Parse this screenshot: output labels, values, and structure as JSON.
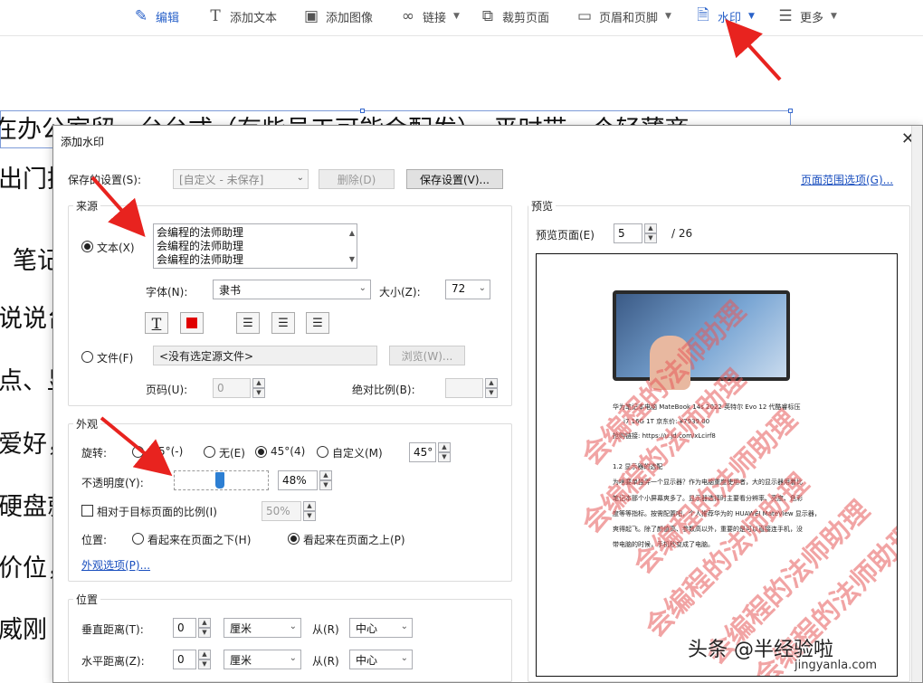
{
  "toolbar": {
    "edit": "编辑",
    "add_text": "添加文本",
    "add_image": "添加图像",
    "link": "链接",
    "crop": "裁剪页面",
    "header_footer": "页眉和页脚",
    "watermark": "水印",
    "more": "更多"
  },
  "document": {
    "lines": [
      "在办公室留一台台式（有些员工可能会配发），平时带一个轻薄商",
      "出门携",
      "笔记",
      "说说台",
      "点、显",
      "爱好，",
      "硬盘就",
      "价位，",
      "威刚"
    ]
  },
  "dialog": {
    "title": "添加水印",
    "saved_settings_label": "保存的设置(S):",
    "saved_settings_value": "[自定义 - 未保存]",
    "delete_button": "删除(D)",
    "save_settings_button": "保存设置(V)...",
    "page_range_link": "页面范围选项(G)...",
    "source": {
      "title": "来源",
      "text_radio": "文本(X)",
      "text_lines": [
        "会编程的法师助理",
        "会编程的法师助理",
        "会编程的法师助理"
      ],
      "font_label": "字体(N):",
      "font_value": "隶书",
      "size_label": "大小(Z):",
      "size_value": "72",
      "file_radio": "文件(F)",
      "file_value": "<没有选定源文件>",
      "browse_button": "浏览(W)...",
      "page_label": "页码(U):",
      "page_value": "0",
      "abs_scale_label": "绝对比例(B):"
    },
    "appearance": {
      "title": "外观",
      "rotation_label": "旋转:",
      "rot_neg45": "-45°(-)",
      "rot_none": "无(E)",
      "rot_45": "45°(4)",
      "rot_custom": "自定义(M)",
      "rot_custom_value": "45°",
      "opacity_label": "不透明度(Y):",
      "opacity_value": "48%",
      "opacity_level": 0.48,
      "relative_scale_label": "相对于目标页面的比例(I)",
      "relative_scale_value": "50%",
      "position_label": "位置:",
      "behind_page": "看起来在页面之下(H)",
      "on_top_page": "看起来在页面之上(P)",
      "options_link": "外观选项(P)..."
    },
    "position": {
      "title": "位置",
      "vertical_label": "垂直距离(T):",
      "vertical_value": "0",
      "vertical_unit": "厘米",
      "vertical_from_label": "从(R)",
      "vertical_from_value": "中心",
      "horizontal_label": "水平距离(Z):",
      "horizontal_value": "0",
      "horizontal_unit": "厘米",
      "horizontal_from_label": "从(R)",
      "horizontal_from_value": "中心"
    },
    "preview": {
      "title": "预览",
      "page_label": "预览页面(E)",
      "page_value": "5",
      "page_total": "/ 26",
      "watermark_text": "会编程的法师助理",
      "content_lines": [
        "华为笔记本电脑 MateBook 14s 2022 英特尔 Evo 12 代酷睿标压",
        "i7 16G 1T 京东价: ¥7939.00",
        "抢购链接: https://u.jd.com/xLcirf8",
        "1.2 显示器的选配",
        "为啥要单独弄一个显示器？作为电脑重度使用者，大的显示器用着比",
        "笔记本那个小屏幕爽多了。显示器选择时主要看分辨率、亮度、色彩",
        "度等等指标。按需配置吧，个人推荐华为的 HUAWEI MateView 显示器，",
        "爽得起飞。除了颜值高、参数高以外，重要的是可以直接连手机，没",
        "带电脑的时候，手机秒变成了电脑。"
      ]
    }
  },
  "brand": {
    "text": "头条 @半经验啦",
    "site": "jingyanla.com"
  }
}
